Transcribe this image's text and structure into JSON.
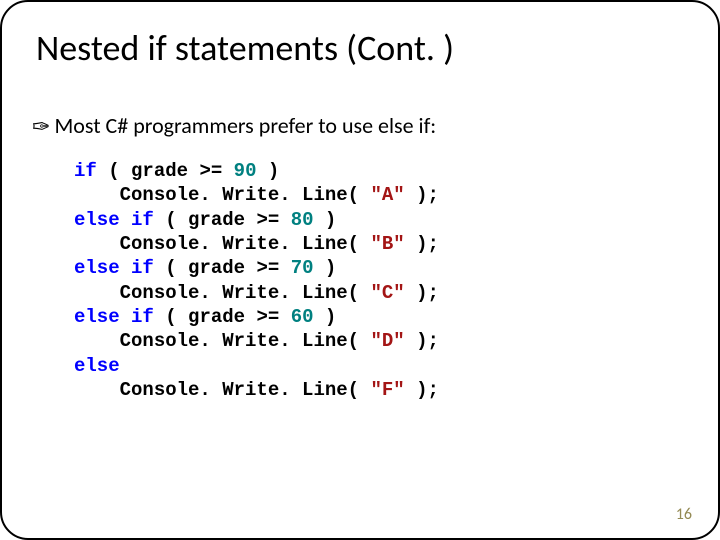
{
  "title": "Nested if statements (Cont. )",
  "bullet": "Most C# programmers prefer to use else if:",
  "code": {
    "kw_if": "if",
    "kw_else": "else",
    "lp": "(",
    "rp": ")",
    "semi": ";",
    "var": "grade",
    "op": ">=",
    "n90": "90",
    "n80": "80",
    "n70": "70",
    "n60": "60",
    "call": "Console. Write. Line(",
    "strA": "\"A\"",
    "strB": "\"B\"",
    "strC": "\"C\"",
    "strD": "\"D\"",
    "strF": "\"F\""
  },
  "page_number": "16"
}
